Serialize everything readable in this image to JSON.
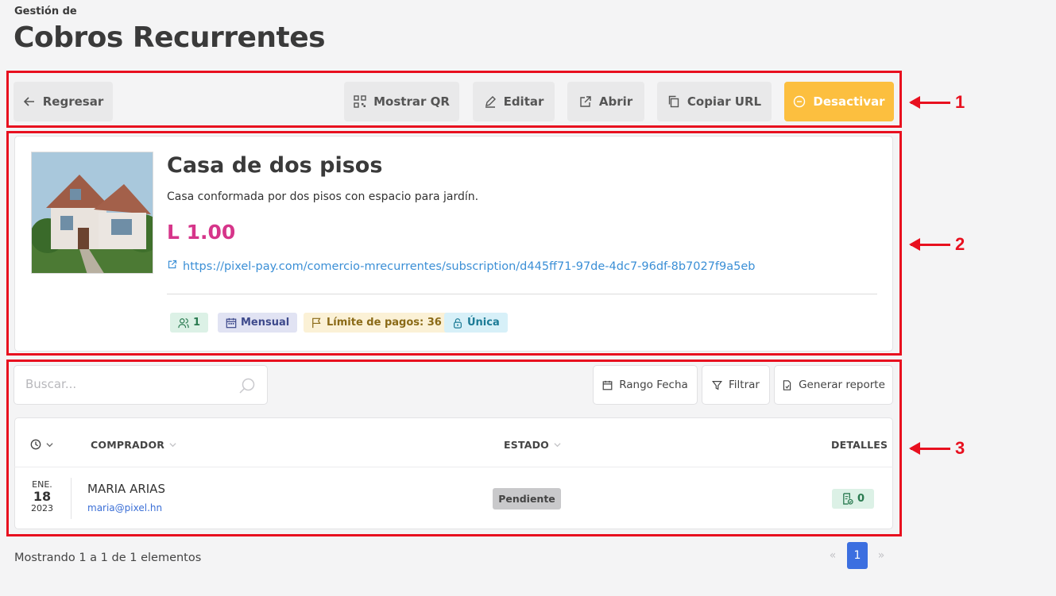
{
  "header": {
    "subtitle": "Gestión de",
    "title": "Cobros Recurrentes"
  },
  "toolbar": {
    "back_label": "Regresar",
    "qr_label": "Mostrar QR",
    "edit_label": "Editar",
    "open_label": "Abrir",
    "copy_label": "Copiar URL",
    "deactivate_label": "Desactivar"
  },
  "product": {
    "title": "Casa de dos pisos",
    "description": "Casa conformada por dos pisos con espacio para jardín.",
    "price": "L 1.00",
    "url": "https://pixel-pay.com/comercio-mrecurrentes/subscription/d445ff71-97de-4dc7-96df-8b7027f9a5eb",
    "badges": {
      "users": "1",
      "frequency": "Mensual",
      "limit": "Límite de pagos: 36",
      "type": "Única"
    }
  },
  "filters": {
    "search_placeholder": "Buscar...",
    "date_range_label": "Rango Fecha",
    "filter_label": "Filtrar",
    "report_label": "Generar reporte"
  },
  "table": {
    "headers": {
      "buyer": "COMPRADOR",
      "status": "ESTADO",
      "details": "DETALLES"
    },
    "rows": [
      {
        "month": "ENE.",
        "day": "18",
        "year": "2023",
        "name": "MARIA ARIAS",
        "email": "maria@pixel.hn",
        "status": "Pendiente",
        "details_count": "0"
      }
    ]
  },
  "footer": {
    "showing_text": "Mostrando 1 a 1 de 1 elementos",
    "prev": "«",
    "page": "1",
    "next": "»"
  },
  "callouts": [
    "1",
    "2",
    "3"
  ],
  "colors": {
    "accent_warning": "#fcbf3f",
    "price": "#d6358a",
    "link": "#3b8fd6",
    "annotation": "#e8101f",
    "pagination_active": "#3c6fe0"
  }
}
